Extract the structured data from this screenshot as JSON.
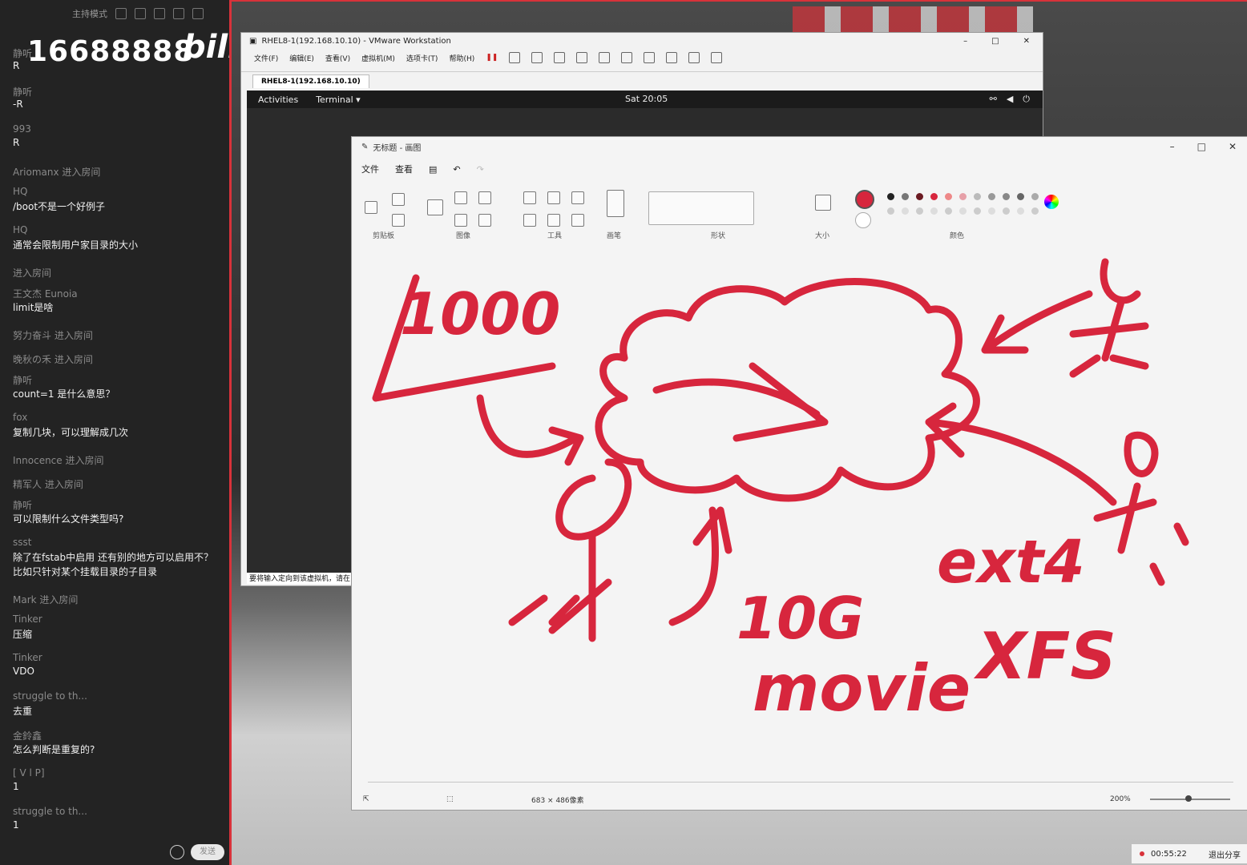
{
  "chat": {
    "mode_label": "主持模式",
    "overlay_number": "16688888",
    "overlay_logo": "bili",
    "messages": [
      {
        "user": "静听",
        "text": "R"
      },
      {
        "user": "静听",
        "text": "-R"
      },
      {
        "user": "993",
        "text": "R"
      },
      {
        "user": "Ariomanx 进入房间",
        "text": ""
      },
      {
        "user": "HQ",
        "text": "/boot不是一个好例子"
      },
      {
        "user": "HQ",
        "text": "通常会限制用户家目录的大小"
      },
      {
        "user": "进入房间",
        "text": ""
      },
      {
        "user": "王文杰 Eunoia",
        "text": "limit是啥"
      },
      {
        "user": "努力奋斗 进入房间",
        "text": ""
      },
      {
        "user": "晚秋の禾 进入房间",
        "text": ""
      },
      {
        "user": "静听",
        "text": "count=1 是什么意思？"
      },
      {
        "user": "fox",
        "text": "复制几块，可以理解成几次"
      },
      {
        "user": "Innocence 进入房间",
        "text": ""
      },
      {
        "user": "精军人 进入房间",
        "text": ""
      },
      {
        "user": "静听",
        "text": "可以限制什么文件类型吗?"
      },
      {
        "user": "ssst",
        "text": "除了在fstab中启用 还有别的地方可以启用不？比如只针对某个挂载目录的子目录"
      },
      {
        "user": "Mark 进入房间",
        "text": ""
      },
      {
        "user": "Tinker",
        "text": "压缩"
      },
      {
        "user": "Tinker",
        "text": "VDO"
      },
      {
        "user": "struggle to th...",
        "text": "去重"
      },
      {
        "user": "金鈴鑫",
        "text": "怎么判断是重复的?"
      },
      {
        "user": "[ V l P]",
        "text": "1"
      },
      {
        "user": "struggle to th...",
        "text": "1"
      }
    ],
    "send_label": "发送"
  },
  "vmware": {
    "title": "RHEL8-1(192.168.10.10) - VMware Workstation",
    "menu": [
      "文件(F)",
      "编辑(E)",
      "查看(V)",
      "虚拟机(M)",
      "选项卡(T)",
      "帮助(H)"
    ],
    "tab": "RHEL8-1(192.168.10.10)",
    "gnome": {
      "activities": "Activities",
      "terminal": "Terminal ▾",
      "clock": "Sat 20:05"
    },
    "status": "要将输入定向到该虚拟机，请在"
  },
  "paint": {
    "title": "无标题 - 画图",
    "menu": [
      "文件",
      "查看"
    ],
    "groups": [
      "剪贴板",
      "图像",
      "工具",
      "画笔",
      "形状",
      "大小",
      "颜色"
    ],
    "dims": "683 × 486像素",
    "zoom": "200%",
    "drawing_texts": [
      "1000",
      "10G",
      "movie",
      "ext4",
      "XFS"
    ],
    "ink_color": "#d7263d"
  },
  "recording": {
    "time": "00:55:22",
    "exit_label": "退出分享"
  }
}
